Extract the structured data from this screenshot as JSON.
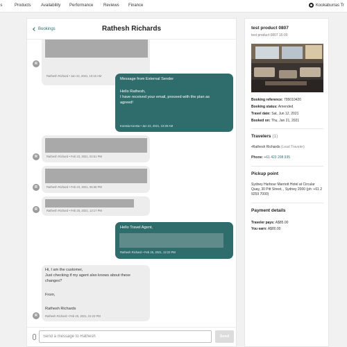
{
  "nav": {
    "items": [
      "gs",
      "Products",
      "Availability",
      "Performance",
      "Reviews",
      "Finance"
    ],
    "brand": "Kookaburras Tr"
  },
  "chat": {
    "back_label": "Bookings",
    "title": "Rathesh Richards",
    "messages": [
      {
        "direction": "in",
        "meta": "Rathesh Richard • Jan 22, 2021, 10:15 AM"
      },
      {
        "direction": "out",
        "header": "Message from External Sender",
        "lines": [
          "Hello Rathesh,",
          "I have received your email, proceed with the plan as",
          "agreed!"
        ],
        "meta": "Konstia Konsta • Jan 22, 2021, 10:29 AM"
      },
      {
        "direction": "in",
        "meta": "Rathesh Richard • Feb 23, 2021, 02:51 PM"
      },
      {
        "direction": "in",
        "meta": "Rathesh Richard • Feb 23, 2021, 05:38 PM"
      },
      {
        "direction": "in",
        "meta": "Rathesh Richard • Feb 25, 2021, 12:17 PM"
      },
      {
        "direction": "out",
        "header": "Hello Travel Agent,",
        "meta": "Rathesh Richard • Feb 25, 2021, 12:22 PM"
      },
      {
        "direction": "in",
        "lines": [
          "Hi, I am the customer,",
          "Just checking if my agent also knows about these",
          "changes?",
          "",
          "From,",
          "",
          "Rathesh Richards"
        ],
        "meta": "Rathesh Richard • Feb 25, 2021, 01:23 PM"
      }
    ],
    "avatar_initial": "R",
    "composer": {
      "placeholder": "Send a message to Rathesh",
      "send_label": "Send"
    }
  },
  "side": {
    "product_title": "test product 0807",
    "product_sub": "test product 0807 15:00",
    "booking_reference_label": "Booking reference:",
    "booking_reference": "795010420",
    "booking_status_label": "Booking status:",
    "booking_status": "Amended",
    "travel_date_label": "Travel date:",
    "travel_date": "Sat, Jun 12, 2021",
    "booked_on_label": "Booked on:",
    "booked_on": "Thu, Jan 21, 2021",
    "travelers_title": "Travelers",
    "travelers_count": "(1)",
    "traveler_name": "•Rathesh Richards",
    "traveler_role": "(Lead Traveler)",
    "phone_label": "Phone:",
    "phone": "+61 423 208 935",
    "pickup_title": "Pickup point",
    "pickup_address": "Sydney Harbour Marriott Hotel at Circular Quay, 30 Pitt Street, , Sydney 2000 (ph: +61 2 9259 7000)",
    "payment_title": "Payment details",
    "traveler_pays_label": "Traveler pays:",
    "traveler_pays": "A$85.00",
    "you_earn_label": "You earn:",
    "you_earn": "A$80.00"
  },
  "colors": {
    "accent": "#2e6d6b",
    "incoming_bubble": "#ededed",
    "redaction": "#a9a9a9"
  }
}
